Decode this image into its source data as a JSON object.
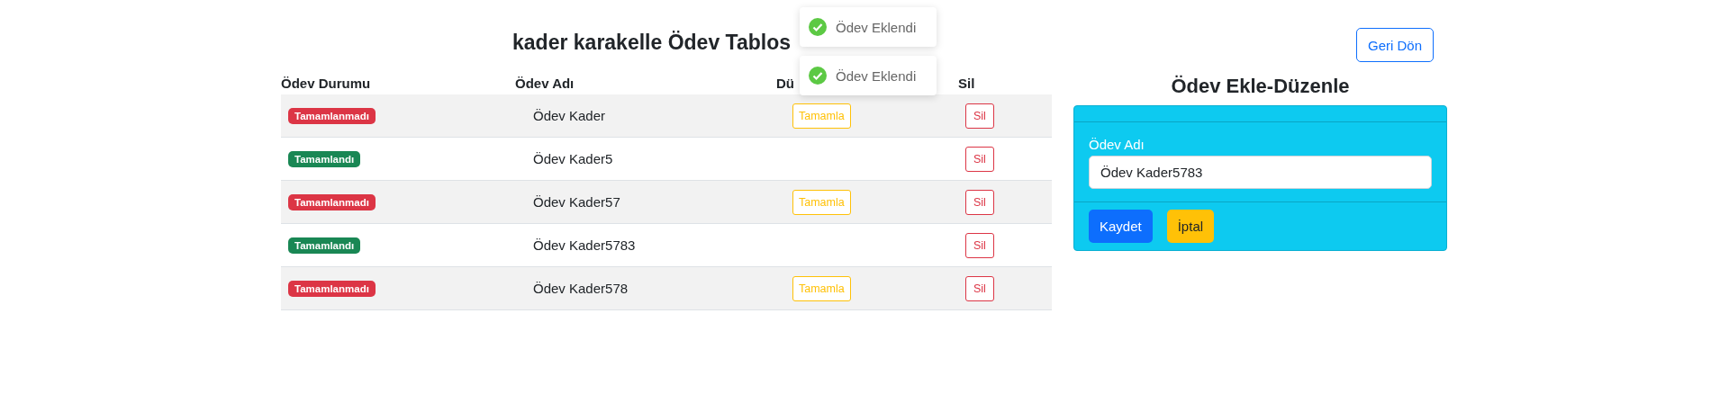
{
  "title": "kader karakelle Ödev Tablos",
  "toasts": [
    {
      "message": "Ödev Eklendi"
    },
    {
      "message": "Ödev Eklendi"
    }
  ],
  "table": {
    "columns": [
      "Ödev Durumu",
      "Ödev Adı",
      "Dü",
      "Sil"
    ],
    "rows": [
      {
        "completed": false,
        "status": "Tamamlanmadı",
        "name": "Ödev Kader",
        "complete_button": "Tamamla",
        "delete_button": "Sil"
      },
      {
        "completed": true,
        "status": "Tamamlandı",
        "name": "Ödev Kader5",
        "delete_button": "Sil"
      },
      {
        "completed": false,
        "status": "Tamamlanmadı",
        "name": "Ödev Kader57",
        "complete_button": "Tamamla",
        "delete_button": "Sil"
      },
      {
        "completed": true,
        "status": "Tamamlandı",
        "name": "Ödev Kader5783",
        "delete_button": "Sil"
      },
      {
        "completed": false,
        "status": "Tamamlanmadı",
        "name": "Ödev Kader578",
        "complete_button": "Tamamla",
        "delete_button": "Sil"
      }
    ]
  },
  "back_button": "Geri Dön",
  "form": {
    "title": "Ödev Ekle-Düzenle",
    "label": "Ödev Adı",
    "value": "Ödev Kader5783",
    "save_button": "Kaydet",
    "cancel_button": "İptal"
  }
}
